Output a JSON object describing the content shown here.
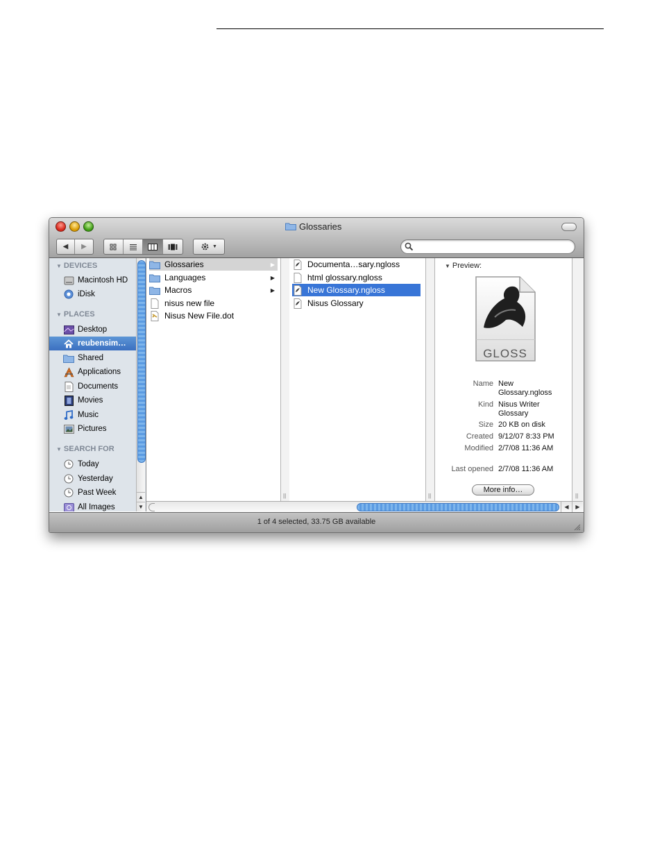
{
  "window": {
    "title": "Glossaries",
    "status": "1 of 4 selected, 33.75 GB available"
  },
  "toolbar": {
    "back_icon": "back-arrow-icon",
    "forward_icon": "forward-arrow-icon",
    "views": [
      "icon-view",
      "list-view",
      "column-view",
      "coverflow-view"
    ],
    "selected_view": "column-view",
    "action_icon": "gear-icon",
    "search": {
      "value": "",
      "placeholder": ""
    }
  },
  "sidebar": {
    "sections": [
      {
        "title": "DEVICES",
        "items": [
          {
            "label": "Macintosh HD",
            "icon": "hard-drive-icon"
          },
          {
            "label": "iDisk",
            "icon": "idisk-icon"
          }
        ]
      },
      {
        "title": "PLACES",
        "items": [
          {
            "label": "Desktop",
            "icon": "desktop-icon"
          },
          {
            "label": "reubensim…",
            "icon": "home-icon",
            "selected": true
          },
          {
            "label": "Shared",
            "icon": "folder-icon"
          },
          {
            "label": "Applications",
            "icon": "applications-icon"
          },
          {
            "label": "Documents",
            "icon": "documents-icon"
          },
          {
            "label": "Movies",
            "icon": "movies-icon"
          },
          {
            "label": "Music",
            "icon": "music-icon"
          },
          {
            "label": "Pictures",
            "icon": "pictures-icon"
          }
        ]
      },
      {
        "title": "SEARCH FOR",
        "items": [
          {
            "label": "Today",
            "icon": "clock-icon"
          },
          {
            "label": "Yesterday",
            "icon": "clock-icon"
          },
          {
            "label": "Past Week",
            "icon": "clock-icon"
          },
          {
            "label": "All Images",
            "icon": "images-icon"
          }
        ]
      }
    ]
  },
  "columns": [
    {
      "items": [
        {
          "label": "Glossaries",
          "icon": "folder-icon",
          "folder": true,
          "state": "parent-selected"
        },
        {
          "label": "Languages",
          "icon": "folder-icon",
          "folder": true
        },
        {
          "label": "Macros",
          "icon": "folder-icon",
          "folder": true
        },
        {
          "label": "nisus new file",
          "icon": "blank-document-icon"
        },
        {
          "label": "Nisus New File.dot",
          "icon": "nisus-document-icon"
        }
      ]
    },
    {
      "items": [
        {
          "label": "Documenta…sary.ngloss",
          "icon": "glossary-file-icon"
        },
        {
          "label": "html glossary.ngloss",
          "icon": "blank-document-icon"
        },
        {
          "label": "New Glossary.ngloss",
          "icon": "glossary-file-icon",
          "state": "selected"
        },
        {
          "label": "Nisus Glossary",
          "icon": "glossary-file-icon"
        }
      ]
    }
  ],
  "preview": {
    "heading": "Preview:",
    "icon_label": "GLOSS",
    "info": [
      {
        "label": "Name",
        "value": "New Glossary.ngloss"
      },
      {
        "label": "Kind",
        "value": "Nisus Writer Glossary"
      },
      {
        "label": "Size",
        "value": "20 KB on disk"
      },
      {
        "label": "Created",
        "value": "9/12/07 8:33 PM"
      },
      {
        "label": "Modified",
        "value": "2/7/08 11:36 AM"
      },
      {
        "label": "Last opened",
        "value": "2/7/08 11:36 AM"
      }
    ],
    "more_info": "More info…"
  },
  "colors": {
    "selection_blue": "#3875d7",
    "sidebar_bg": "#dee4ea",
    "sidebar_header": "#7f8895"
  }
}
